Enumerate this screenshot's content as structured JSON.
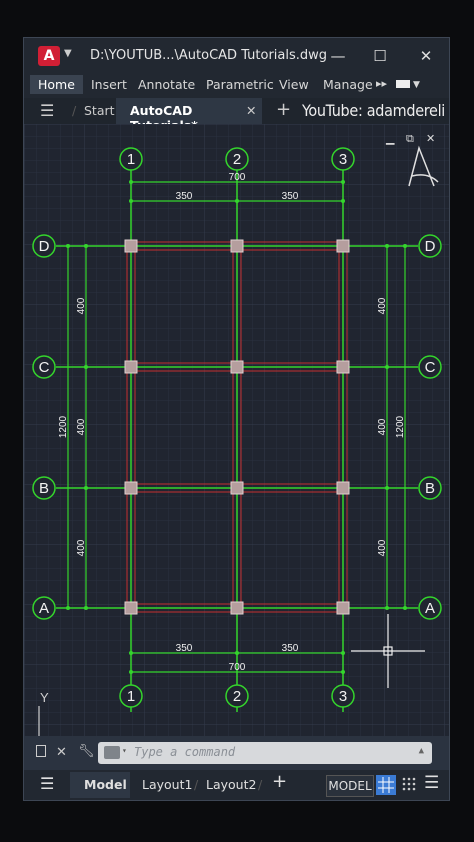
{
  "titlebar": {
    "app_letter": "A",
    "title": "D:\\YOUTUB...\\AutoCAD Tutorials.dwg"
  },
  "ribbon": {
    "tabs": [
      "Home",
      "Insert",
      "Annotate",
      "Parametric",
      "View",
      "Manage"
    ]
  },
  "filetabs": {
    "start": "Start",
    "active": "AutoCAD Tutorials*",
    "watermark": "YouTube: adamdereli"
  },
  "drawing": {
    "columns": [
      "1",
      "2",
      "3"
    ],
    "rows": [
      "D",
      "C",
      "B",
      "A"
    ],
    "dim_total_x": "700",
    "dim_bay_x": [
      "350",
      "350"
    ],
    "dim_total_y": "1200",
    "dim_bay_y": [
      "400",
      "400",
      "400"
    ]
  },
  "command": {
    "placeholder": "Type a command"
  },
  "statusbar": {
    "tabs": [
      "Model",
      "Layout1",
      "Layout2"
    ],
    "model_button": "MODEL"
  },
  "colors": {
    "grid_green": "#34d52c",
    "column_gray": "#c8b4b4",
    "beam_red": "#c43030",
    "background": "#202530"
  }
}
